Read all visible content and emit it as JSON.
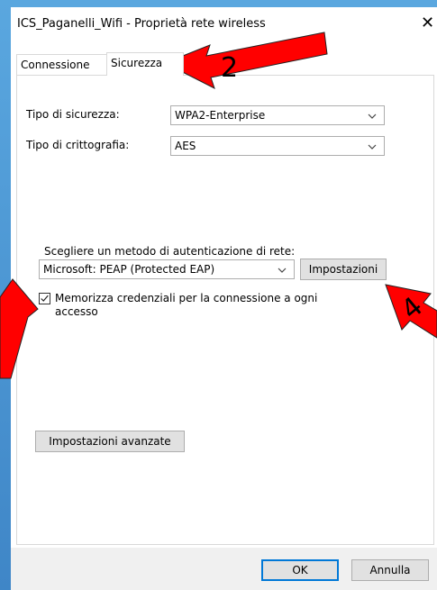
{
  "window": {
    "title": "ICS_Paganelli_Wifi - Proprietà rete wireless",
    "close_glyph": "✕"
  },
  "tabs": [
    {
      "label": "Connessione",
      "active": false
    },
    {
      "label": "Sicurezza",
      "active": true
    }
  ],
  "security": {
    "type_label": "Tipo di sicurezza:",
    "type_value": "WPA2-Enterprise",
    "encryption_label": "Tipo di crittografia:",
    "encryption_value": "AES"
  },
  "auth": {
    "method_label": "Scegliere un metodo di autenticazione di rete:",
    "method_value": "Microsoft: PEAP (Protected EAP)",
    "settings_button": "Impostazioni",
    "remember_label_line1": "Memorizza credenziali per la connessione a ogni",
    "remember_label_line2": "accesso",
    "remember_checked": true
  },
  "advanced_button": "Impostazioni avanzate",
  "footer": {
    "ok_label": "OK",
    "cancel_label": "Annulla"
  },
  "annotations": {
    "arrow_color": "#ff0000",
    "step_2": "2",
    "step_4": "4"
  }
}
